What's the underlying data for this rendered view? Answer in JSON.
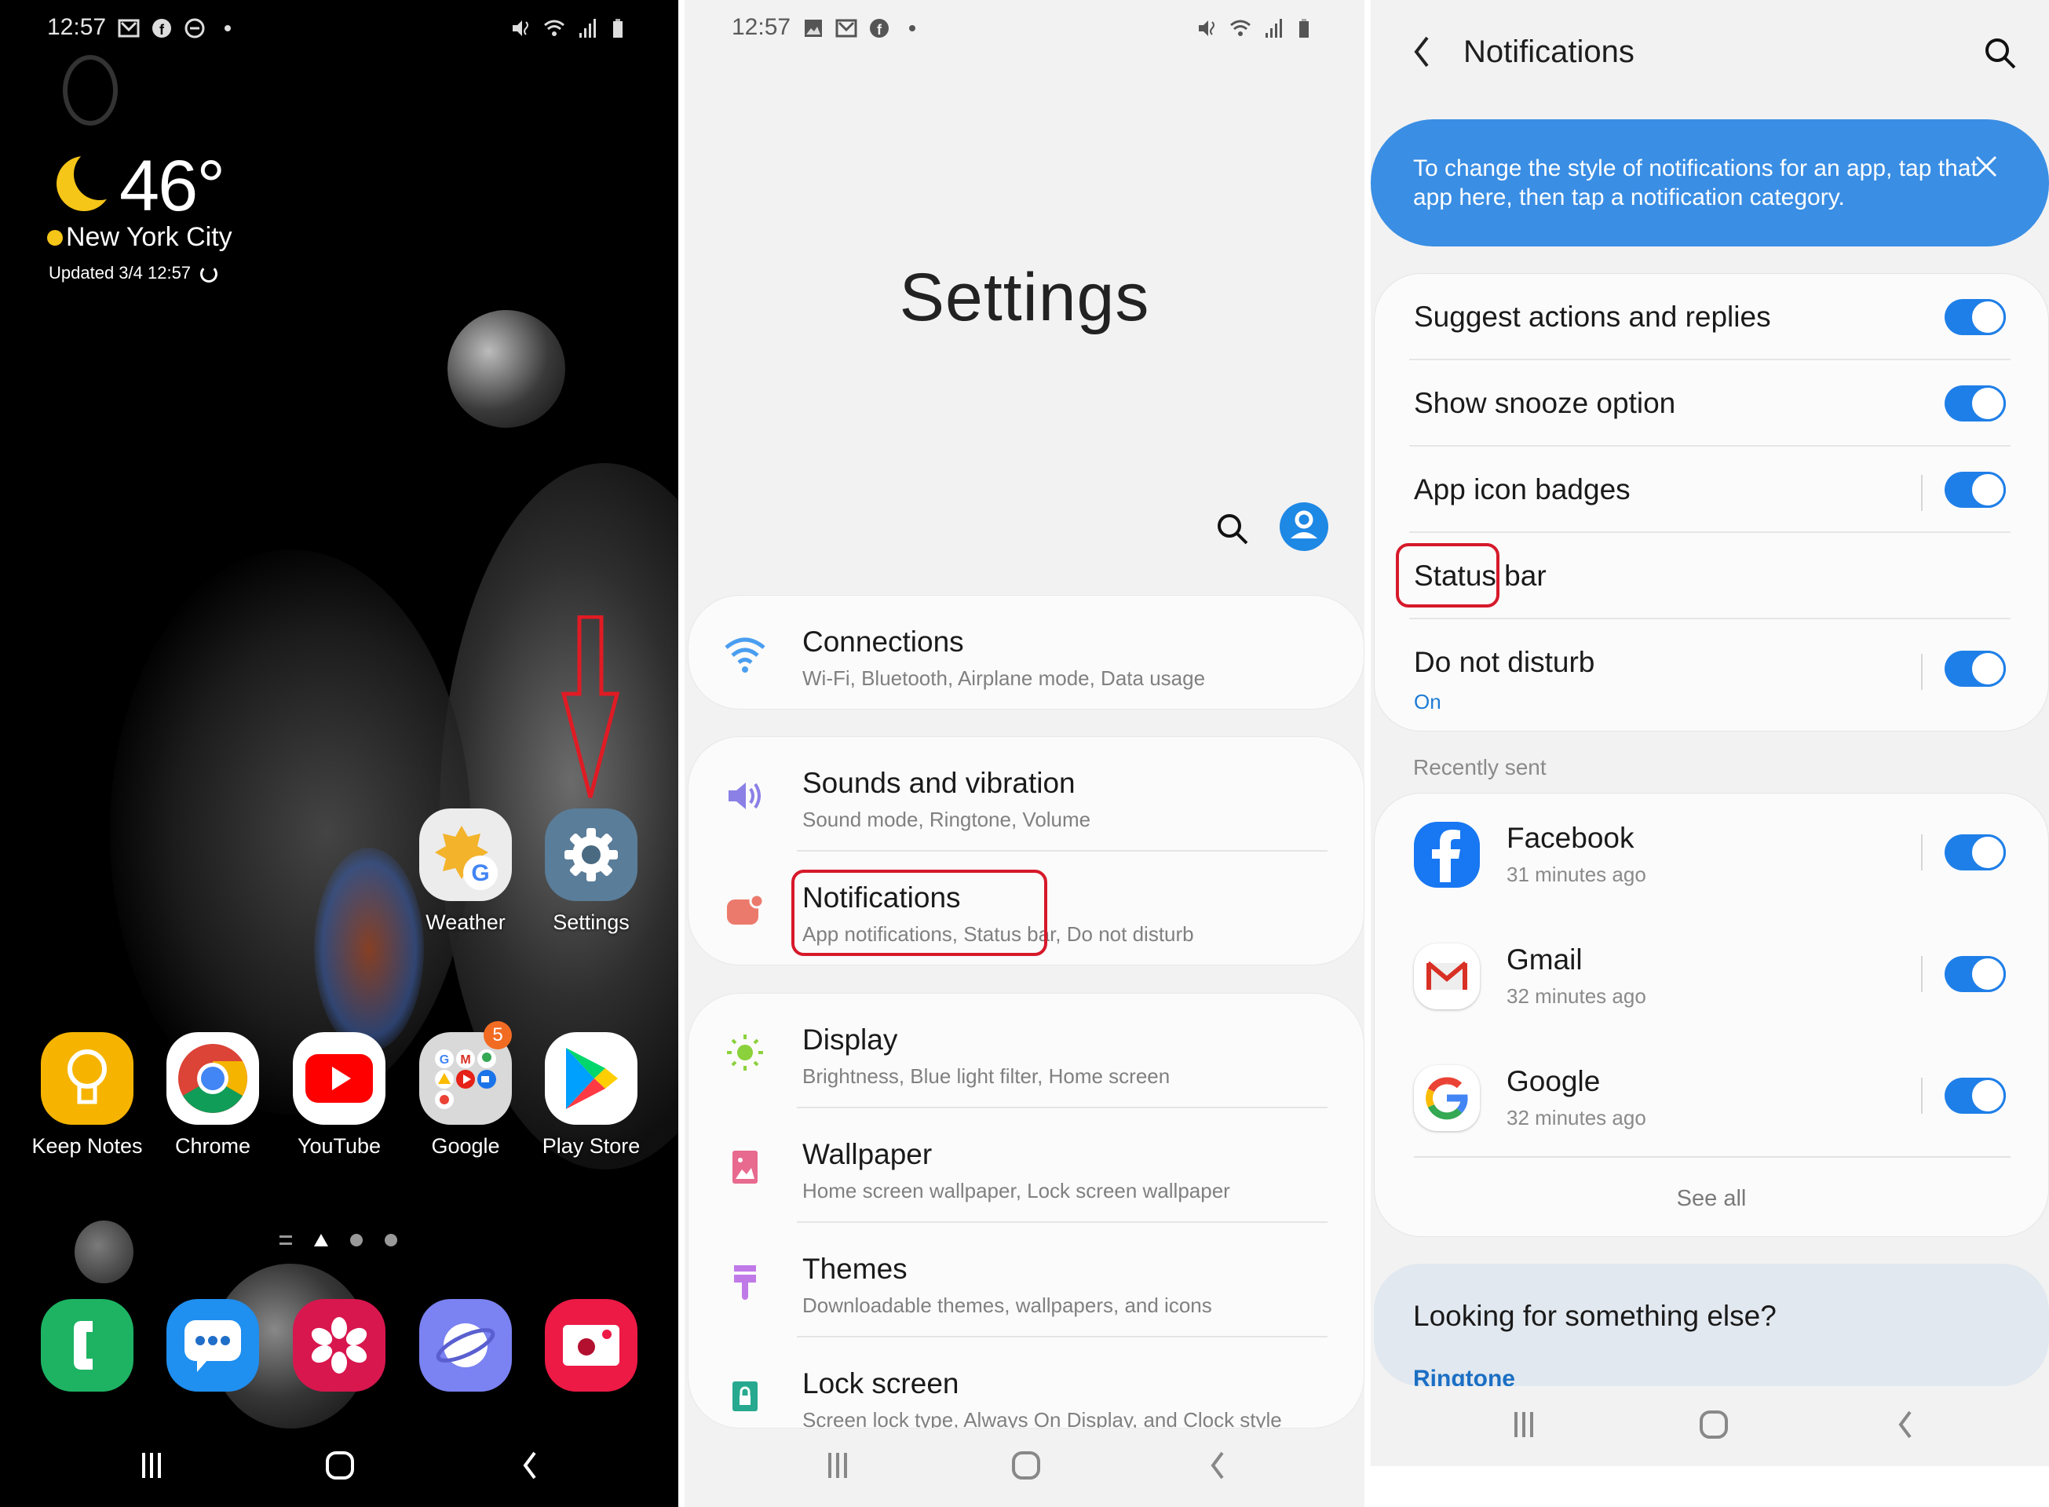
{
  "home": {
    "status_bar": {
      "time": "12:57",
      "left_icons": [
        "gmail-icon",
        "facebook-icon",
        "dnd-icon",
        "dot-icon"
      ],
      "right_icons": [
        "mute-vibrate-icon",
        "wifi-icon",
        "signal-icon",
        "battery-icon"
      ]
    },
    "weather": {
      "icon": "moon-icon",
      "temperature": "46°",
      "city": "New York City",
      "updated": "Updated 3/4 12:57"
    },
    "top_apps": [
      {
        "name": "Weather",
        "icon": "weather-icon"
      },
      {
        "name": "Settings",
        "icon": "gear-icon"
      }
    ],
    "app_row": [
      {
        "name": "Keep Notes",
        "icon": "keep-notes-icon"
      },
      {
        "name": "Chrome",
        "icon": "chrome-icon"
      },
      {
        "name": "YouTube",
        "icon": "youtube-icon"
      },
      {
        "name": "Google",
        "icon": "google-folder-icon",
        "badge": "5"
      },
      {
        "name": "Play Store",
        "icon": "play-store-icon"
      }
    ],
    "dock": [
      {
        "name": "Phone",
        "icon": "phone-icon",
        "color": "#1db363"
      },
      {
        "name": "Messages",
        "icon": "messages-icon",
        "color": "#1f8ff0"
      },
      {
        "name": "Gallery",
        "icon": "gallery-icon",
        "color": "#d8174e"
      },
      {
        "name": "Internet",
        "icon": "internet-icon",
        "color": "#7b82f2"
      },
      {
        "name": "Camera",
        "icon": "camera-icon",
        "color": "#ec1a45"
      }
    ],
    "annotation": "arrow pointing to Settings"
  },
  "settings": {
    "status_bar": {
      "time": "12:57",
      "left_icons": [
        "gallery-icon",
        "gmail-icon",
        "facebook-icon",
        "dot-icon"
      ],
      "right_icons": [
        "mute-vibrate-icon",
        "wifi-icon",
        "signal-icon",
        "battery-icon"
      ]
    },
    "title": "Settings",
    "groups": [
      [
        {
          "title": "Connections",
          "subtitle": "Wi-Fi, Bluetooth, Airplane mode, Data usage",
          "icon": "wifi-icon",
          "color": "#4a9ef0"
        }
      ],
      [
        {
          "title": "Sounds and vibration",
          "subtitle": "Sound mode, Ringtone, Volume",
          "icon": "speaker-icon",
          "color": "#8a80e6"
        },
        {
          "title": "Notifications",
          "subtitle": "App notifications, Status bar, Do not disturb",
          "icon": "notification-icon",
          "color": "#ec7a6c",
          "highlighted": true
        }
      ],
      [
        {
          "title": "Display",
          "subtitle": "Brightness, Blue light filter, Home screen",
          "icon": "sun-icon",
          "color": "#8bd13b"
        },
        {
          "title": "Wallpaper",
          "subtitle": "Home screen wallpaper, Lock screen wallpaper",
          "icon": "wallpaper-icon",
          "color": "#e86a8f"
        },
        {
          "title": "Themes",
          "subtitle": "Downloadable themes, wallpapers, and icons",
          "icon": "brush-icon",
          "color": "#c07ae8"
        },
        {
          "title": "Lock screen",
          "subtitle": "Screen lock type, Always On Display, and Clock style",
          "icon": "lock-icon",
          "color": "#27a98f"
        }
      ]
    ]
  },
  "notifications": {
    "header": {
      "title": "Notifications"
    },
    "tip": "To change the style of notifications for an app, tap that app here, then tap a notification category.",
    "options": [
      {
        "label": "Suggest actions and replies",
        "toggle": true,
        "separator": false
      },
      {
        "label": "Show snooze option",
        "toggle": true,
        "separator": false
      },
      {
        "label": "App icon badges",
        "toggle": true,
        "separator": true
      },
      {
        "label": "Status bar",
        "toggle": null,
        "highlighted": true
      },
      {
        "label": "Do not disturb",
        "sub": "On",
        "toggle": true,
        "separator": true
      }
    ],
    "recent_header": "Recently sent",
    "recent_apps": [
      {
        "name": "Facebook",
        "time": "31 minutes ago",
        "icon": "facebook-icon",
        "enabled": true
      },
      {
        "name": "Gmail",
        "time": "32 minutes ago",
        "icon": "gmail-icon",
        "enabled": true
      },
      {
        "name": "Google",
        "time": "32 minutes ago",
        "icon": "google-icon",
        "enabled": true
      }
    ],
    "see_all": "See all",
    "looking": {
      "title": "Looking for something else?",
      "link": "Ringtone"
    }
  },
  "colors": {
    "accent": "#1f7fe8",
    "tip_bg": "#3a8ee4",
    "highlight": "#d6192a"
  }
}
